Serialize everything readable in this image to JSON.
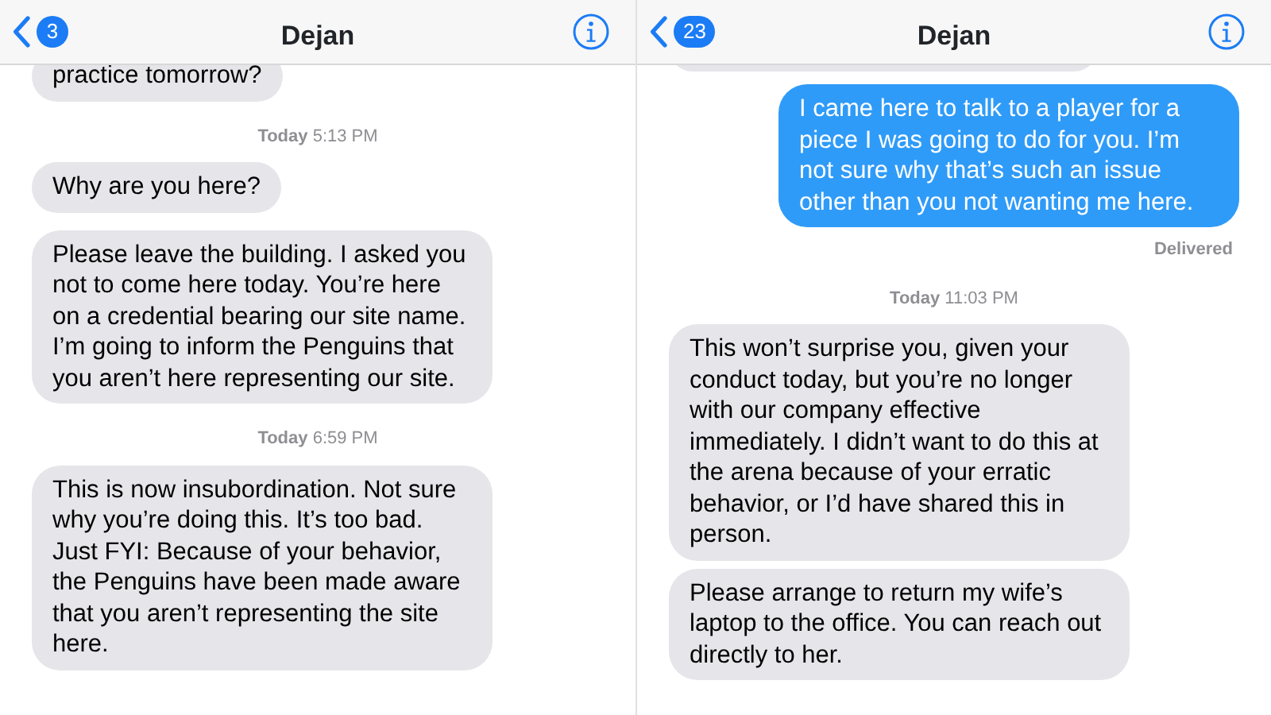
{
  "screens": [
    {
      "header": {
        "back_count": "3",
        "title": "Dejan"
      },
      "messages": [
        {
          "kind": "incoming",
          "text": "practice tomorrow?",
          "cut": true
        },
        {
          "kind": "timestamp",
          "text": "**Today** 5:13 PM"
        },
        {
          "kind": "incoming",
          "text": "Why are you here?"
        },
        {
          "kind": "incoming",
          "text": "Please leave the building. I asked you not to come here today. You’re here on a credential bearing our site name. I’m going to inform the Penguins that you aren’t here representing our site."
        },
        {
          "kind": "timestamp",
          "text": "**Today** 6:59 PM"
        },
        {
          "kind": "incoming",
          "text": "This is now insubordination. Not sure why you’re doing this. It’s too bad. Just FYI: Because of your behavior, the Penguins have been made aware that you aren’t representing the site here."
        }
      ]
    },
    {
      "header": {
        "back_count": "23",
        "title": "Dejan"
      },
      "messages": [
        {
          "kind": "incoming",
          "cut": true
        },
        {
          "kind": "outgoing",
          "text": "I came here to talk to a player for a piece I was going to do for you. I’m not sure why that’s such an issue other than you not wanting me here."
        },
        {
          "kind": "status",
          "text": "Delivered"
        },
        {
          "kind": "timestamp",
          "text": "**Today** 11:03 PM"
        },
        {
          "kind": "incoming",
          "text": "This won’t surprise you, given your conduct today, but you’re no longer with our company effective immediately. I didn’t want to do this at the arena because of your erratic behavior, or I’d have shared this in person."
        },
        {
          "kind": "incoming",
          "text": "Please arrange to return my wife’s laptop to the office. You can reach out directly to her."
        }
      ]
    }
  ]
}
